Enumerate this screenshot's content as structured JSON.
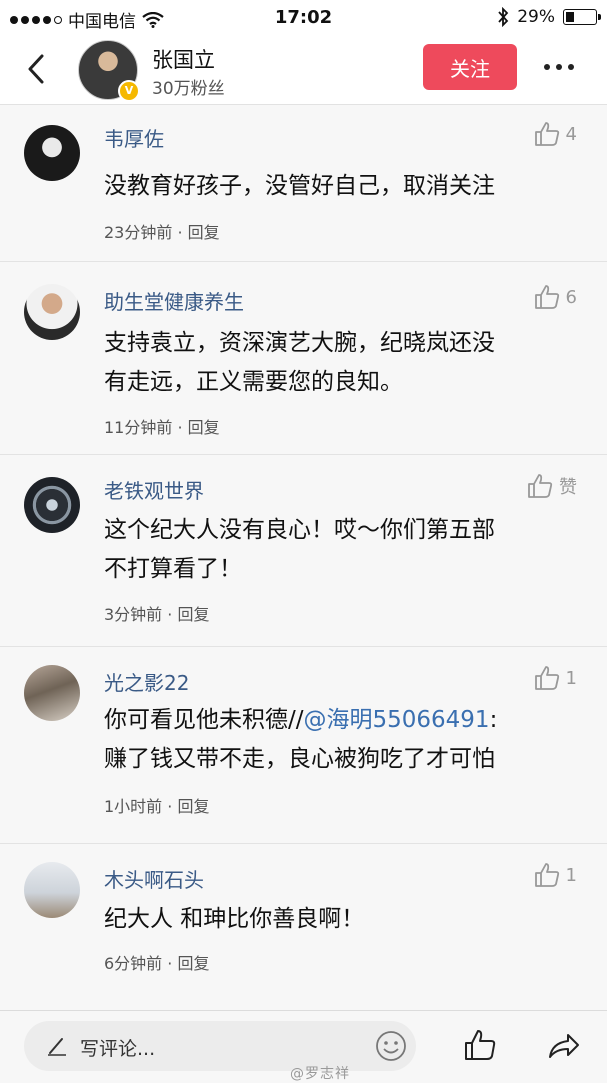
{
  "status_bar": {
    "carrier": "中国电信",
    "time": "17:02",
    "battery": "29%",
    "icons": [
      "signal-dots",
      "wifi-icon",
      "bluetooth-icon",
      "battery-icon"
    ]
  },
  "header": {
    "name": "张国立",
    "fans": "30万粉丝",
    "follow_label": "关注",
    "icons": [
      "back-icon",
      "verified-badge",
      "more-icon"
    ]
  },
  "comments": [
    {
      "name": "韦厚佐",
      "likes": "4",
      "text": "没教育好孩子，没管好自己，取消关注",
      "meta": "23分钟前 · 回复"
    },
    {
      "name": "助生堂健康养生",
      "likes": "6",
      "text_lines": [
        "支持袁立，资深演艺大腕，纪晓岚还没",
        "有走远，正义需要您的良知。"
      ],
      "meta": "11分钟前 · 回复"
    },
    {
      "name": "老铁观世界",
      "likes": "赞",
      "text_lines": [
        "这个纪大人没有良心！哎～你们第五部",
        "不打算看了！"
      ],
      "meta": "3分钟前 · 回复"
    },
    {
      "name": "光之影22",
      "likes": "1",
      "text_prefix": "你可看见他未积德//",
      "mention": "@海明55066491",
      "text_suffix": ":",
      "text_line2": "赚了钱又带不走，良心被狗吃了才可怕",
      "meta": "1小时前 · 回复"
    },
    {
      "name": "木头啊石头",
      "likes": "1",
      "text": "纪大人 和珅比你善良啊！",
      "meta": "6分钟前 · 回复"
    }
  ],
  "bottom_bar": {
    "placeholder": "写评论...",
    "watermark": "@罗志祥",
    "icons": [
      "pen-icon",
      "emoji-icon",
      "like-icon",
      "share-icon"
    ]
  },
  "colors": {
    "follow_button": "#ee4a5c",
    "username": "#3a5a86",
    "mention": "#3a6fb0",
    "verified": "#f5b800"
  }
}
